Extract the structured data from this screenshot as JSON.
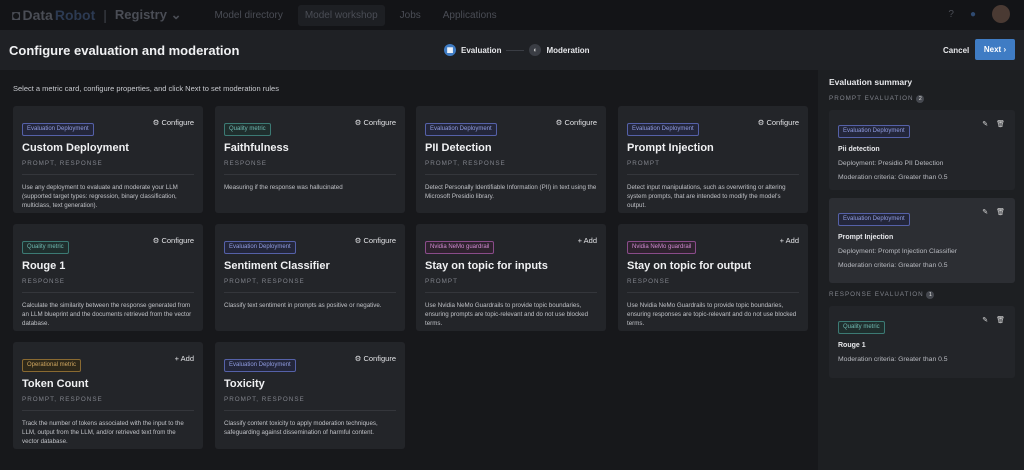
{
  "nav": {
    "brand_a": "Data",
    "brand_b": "Robot",
    "section": "Registry",
    "links": [
      "Model directory",
      "Model workshop",
      "Jobs",
      "Applications"
    ],
    "help": "?"
  },
  "header": {
    "title": "Configure evaluation and moderation",
    "steps": [
      "Evaluation",
      "Moderation"
    ],
    "cancel": "Cancel",
    "next": "Next ›"
  },
  "instruction": "Select a metric card, configure properties, and click Next to set moderation rules",
  "cards": [
    {
      "badge": "Evaluation Deployment",
      "kind": "eval",
      "action": "Configure",
      "title": "Custom Deployment",
      "type": "PROMPT, RESPONSE",
      "desc": "Use any deployment to evaluate and moderate your LLM (supported target types: regression, binary classification, multiclass, text generation)."
    },
    {
      "badge": "Quality metric",
      "kind": "qual",
      "action": "Configure",
      "title": "Faithfulness",
      "type": "RESPONSE",
      "desc": "Measuring if the response was hallucinated"
    },
    {
      "badge": "Evaluation Deployment",
      "kind": "eval",
      "action": "Configure",
      "title": "PII Detection",
      "type": "PROMPT, RESPONSE",
      "desc": "Detect Personally Identifiable Information (PII) in text using the Microsoft Presidio library."
    },
    {
      "badge": "Evaluation Deployment",
      "kind": "eval",
      "action": "Configure",
      "title": "Prompt Injection",
      "type": "PROMPT",
      "desc": "Detect input manipulations, such as overwriting or altering system prompts, that are intended to modify the model's output."
    },
    {
      "badge": "Quality metric",
      "kind": "qual",
      "action": "Configure",
      "title": "Rouge 1",
      "type": "RESPONSE",
      "desc": "Calculate the similarity between the response generated from an LLM blueprint and the documents retrieved from the vector database."
    },
    {
      "badge": "Evaluation Deployment",
      "kind": "eval",
      "action": "Configure",
      "title": "Sentiment Classifier",
      "type": "PROMPT, RESPONSE",
      "desc": "Classify text sentiment in prompts as positive or negative."
    },
    {
      "badge": "Nvidia NeMo guardrail",
      "kind": "nemo",
      "action": "Add",
      "title": "Stay on topic for inputs",
      "type": "PROMPT",
      "desc": "Use Nvidia NeMo Guardrails to provide topic boundaries, ensuring prompts are topic-relevant and do not use blocked terms."
    },
    {
      "badge": "Nvidia NeMo guardrail",
      "kind": "nemo",
      "action": "Add",
      "title": "Stay on topic for output",
      "type": "RESPONSE",
      "desc": "Use Nvidia NeMo Guardrails to provide topic boundaries, ensuring responses are topic-relevant and do not use blocked terms."
    },
    {
      "badge": "Operational metric",
      "kind": "op",
      "action": "Add",
      "title": "Token Count",
      "type": "PROMPT, RESPONSE",
      "desc": "Track the number of tokens associated with the input to the LLM, output from the LLM, and/or retrieved text from the vector database."
    },
    {
      "badge": "Evaluation Deployment",
      "kind": "eval",
      "action": "Configure",
      "title": "Toxicity",
      "type": "PROMPT, RESPONSE",
      "desc": "Classify content toxicity to apply moderation techniques, safeguarding against dissemination of harmful content."
    }
  ],
  "summary": {
    "title": "Evaluation summary",
    "prompt_label": "PROMPT EVALUATION",
    "prompt_count": "2",
    "response_label": "RESPONSE EVALUATION",
    "response_count": "1",
    "items": [
      {
        "badge": "Evaluation Deployment",
        "kind": "eval",
        "name": "Pii detection",
        "deployment": "Deployment: Presidio PII Detection",
        "criteria": "Moderation criteria: Greater than 0.5"
      },
      {
        "badge": "Evaluation Deployment",
        "kind": "eval",
        "name": "Prompt Injection",
        "deployment": "Deployment: Prompt Injection Classifier",
        "criteria": "Moderation criteria: Greater than 0.5"
      },
      {
        "badge": "Quality metric",
        "kind": "qual",
        "name": "Rouge 1",
        "criteria": "Moderation criteria: Greater than 0.5"
      }
    ]
  },
  "colors": {
    "accent": "#3f7cc4",
    "background": "#17181b",
    "card": "#232529"
  }
}
